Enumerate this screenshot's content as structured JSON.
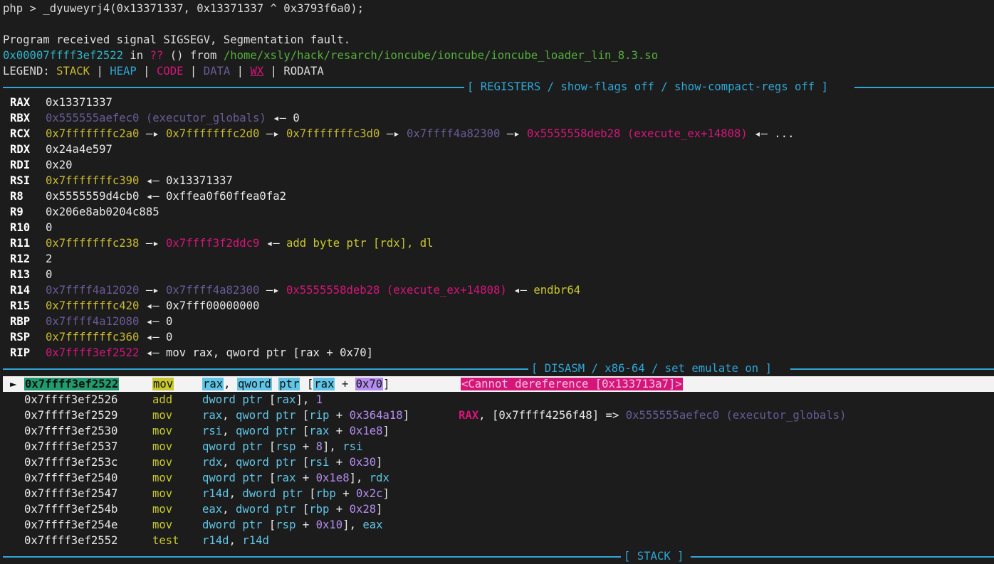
{
  "prompt_line": "php > _dyuweyrj4(0x13371337, 0x13371337 ^ 0x3793f6a0);",
  "signal_line": "Program received signal SIGSEGV, Segmentation fault.",
  "fault": {
    "address": "0x00007ffff3ef2522",
    "in": " in ",
    "unknown": "??",
    "from": " () from ",
    "path": "/home/xsly/hack/resarch/ioncube/ioncube/ioncube_loader_lin_8.3.so"
  },
  "legend": {
    "label": "LEGEND: ",
    "sep": " | ",
    "stack": "STACK",
    "heap": "HEAP",
    "code": "CODE",
    "data": "DATA",
    "wx": "WX",
    "rodata": "RODATA"
  },
  "sections": {
    "registers": "[ REGISTERS / show-flags off / show-compact-regs off ]",
    "disasm": "[ DISASM / x86-64 / set emulate on ]",
    "stack": "[ STACK ]"
  },
  "registers": [
    {
      "name": "RAX",
      "parts": [
        {
          "t": "0x13371337",
          "c": "c-white"
        }
      ]
    },
    {
      "name": "RBX",
      "parts": [
        {
          "t": "0x555555aefec0 (executor_globals)",
          "c": "c-faded"
        },
        {
          "t": " ◂— 0",
          "c": "c-white"
        }
      ]
    },
    {
      "name": "RCX",
      "parts": [
        {
          "t": "0x7fffffffc2a0",
          "c": "c-yellow"
        },
        {
          "t": " —▸ ",
          "c": "c-white"
        },
        {
          "t": "0x7fffffffc2d0",
          "c": "c-yellow"
        },
        {
          "t": " —▸ ",
          "c": "c-white"
        },
        {
          "t": "0x7fffffffc3d0",
          "c": "c-yellow"
        },
        {
          "t": " —▸ ",
          "c": "c-white"
        },
        {
          "t": "0x7ffff4a82300",
          "c": "c-faded"
        },
        {
          "t": " —▸ ",
          "c": "c-white"
        },
        {
          "t": "0x5555558deb28 (execute_ex+14808)",
          "c": "c-code"
        },
        {
          "t": " ◂— ...",
          "c": "c-white"
        }
      ]
    },
    {
      "name": "RDX",
      "parts": [
        {
          "t": "0x24a4e597",
          "c": "c-white"
        }
      ]
    },
    {
      "name": "RDI",
      "parts": [
        {
          "t": "0x20",
          "c": "c-white"
        }
      ]
    },
    {
      "name": "RSI",
      "parts": [
        {
          "t": "0x7fffffffc390",
          "c": "c-yellow"
        },
        {
          "t": " ◂— 0x13371337",
          "c": "c-white"
        }
      ]
    },
    {
      "name": "R8",
      "parts": [
        {
          "t": "0x5555559d4cb0",
          "c": "c-white"
        },
        {
          "t": " ◂— 0xffea0f60ffea0fa2",
          "c": "c-white"
        }
      ]
    },
    {
      "name": "R9",
      "parts": [
        {
          "t": "0x206e8ab0204c885",
          "c": "c-white"
        }
      ]
    },
    {
      "name": "R10",
      "parts": [
        {
          "t": "0",
          "c": "c-white"
        }
      ]
    },
    {
      "name": "R11",
      "parts": [
        {
          "t": "0x7fffffffc238",
          "c": "c-yellow"
        },
        {
          "t": " —▸ ",
          "c": "c-white"
        },
        {
          "t": "0x7ffff3f2ddc9",
          "c": "c-code"
        },
        {
          "t": " ◂— ",
          "c": "c-white"
        },
        {
          "t": "add byte ptr [rdx], dl",
          "c": "c-ins"
        }
      ]
    },
    {
      "name": "R12",
      "parts": [
        {
          "t": "2",
          "c": "c-white"
        }
      ]
    },
    {
      "name": "R13",
      "parts": [
        {
          "t": "0",
          "c": "c-white"
        }
      ]
    },
    {
      "name": "R14",
      "parts": [
        {
          "t": "0x7ffff4a12020",
          "c": "c-faded"
        },
        {
          "t": " —▸ ",
          "c": "c-white"
        },
        {
          "t": "0x7ffff4a82300",
          "c": "c-faded"
        },
        {
          "t": " —▸ ",
          "c": "c-white"
        },
        {
          "t": "0x5555558deb28 (execute_ex+14808)",
          "c": "c-code"
        },
        {
          "t": " ◂— ",
          "c": "c-white"
        },
        {
          "t": "endbr64",
          "c": "c-ins"
        }
      ]
    },
    {
      "name": "R15",
      "parts": [
        {
          "t": "0x7fffffffc420",
          "c": "c-yellow"
        },
        {
          "t": " ◂— 0x7fff00000000",
          "c": "c-white"
        }
      ]
    },
    {
      "name": "RBP",
      "parts": [
        {
          "t": "0x7ffff4a12080",
          "c": "c-faded"
        },
        {
          "t": " ◂— 0",
          "c": "c-white"
        }
      ]
    },
    {
      "name": "RSP",
      "parts": [
        {
          "t": "0x7fffffffc360",
          "c": "c-yellow"
        },
        {
          "t": " ◂— 0",
          "c": "c-white"
        }
      ]
    },
    {
      "name": "RIP",
      "parts": [
        {
          "t": "0x7ffff3ef2522",
          "c": "c-code"
        },
        {
          "t": " ◂— ",
          "c": "c-white"
        },
        {
          "t": "mov rax, qword ptr [rax + 0x70]",
          "c": "c-white"
        }
      ]
    }
  ],
  "current_instruction": {
    "marker": "►",
    "address": "0x7ffff3ef2522",
    "mnemonic": "mov",
    "op1": "rax",
    "comma": ",",
    "qword": "qword",
    "ptr": "ptr",
    "bracket_open": "[",
    "reg": "rax",
    "plus": "+",
    "offset": "0x70",
    "bracket_close": "]",
    "comment": "<Cannot dereference [0x133713a7]>"
  },
  "disasm": [
    {
      "addr": "0x7ffff3ef2526",
      "ins": "add",
      "ops": "dword ptr [rax], 1",
      "cmt": ""
    },
    {
      "addr": "0x7ffff3ef2529",
      "ins": "mov",
      "ops": "rax, qword ptr [rip + 0x364a18]",
      "cmt": "RAX, [0x7ffff4256f48] => 0x555555aefec0 (executor_globals)"
    },
    {
      "addr": "0x7ffff3ef2530",
      "ins": "mov",
      "ops": "rsi, qword ptr [rax + 0x1e8]",
      "cmt": ""
    },
    {
      "addr": "0x7ffff3ef2537",
      "ins": "mov",
      "ops": "qword ptr [rsp + 8], rsi",
      "cmt": ""
    },
    {
      "addr": "0x7ffff3ef253c",
      "ins": "mov",
      "ops": "rdx, qword ptr [rsi + 0x30]",
      "cmt": ""
    },
    {
      "addr": "0x7ffff3ef2540",
      "ins": "mov",
      "ops": "qword ptr [rax + 0x1e8], rdx",
      "cmt": ""
    },
    {
      "addr": "0x7ffff3ef2547",
      "ins": "mov",
      "ops": "r14d, dword ptr [rbp + 0x2c]",
      "cmt": ""
    },
    {
      "addr": "0x7ffff3ef254b",
      "ins": "mov",
      "ops": "eax, dword ptr [rbp + 0x28]",
      "cmt": ""
    },
    {
      "addr": "0x7ffff3ef254e",
      "ins": "mov",
      "ops": "dword ptr [rsp + 0x10], eax",
      "cmt": ""
    },
    {
      "addr": "0x7ffff3ef2552",
      "ins": "test",
      "ops": "r14d, r14d",
      "cmt": ""
    }
  ],
  "colors": {
    "background": "#1c1c1c",
    "stack": "#c9b92e",
    "heap": "#2fa6d6",
    "code": "#d6157a",
    "data": "#6a5b97",
    "rule": "#2fa6d6"
  }
}
